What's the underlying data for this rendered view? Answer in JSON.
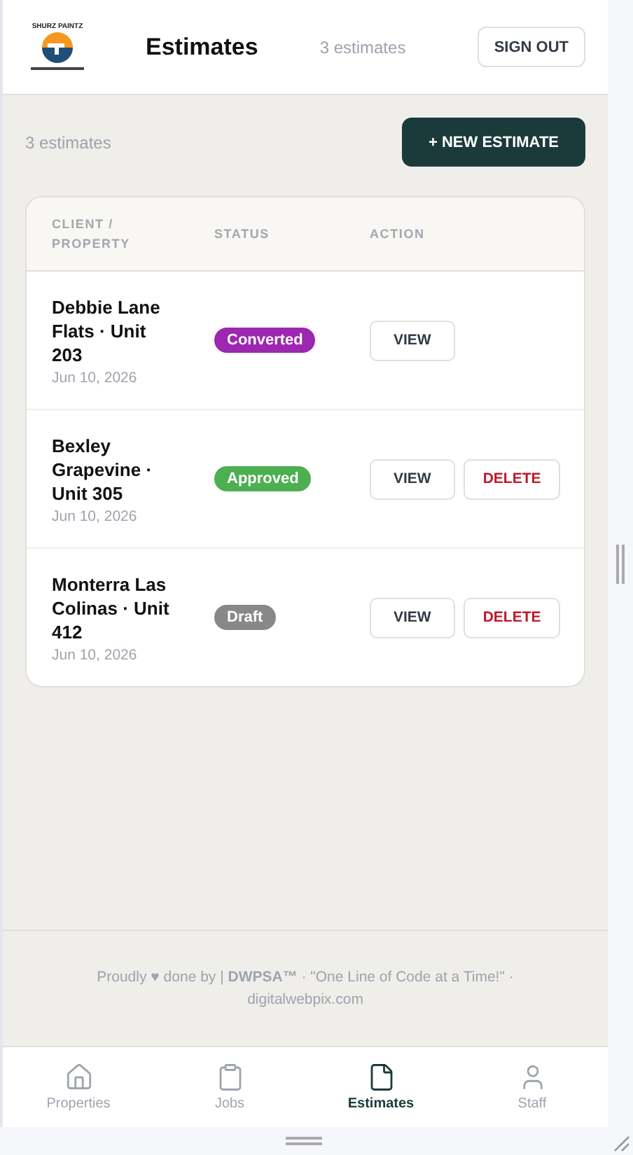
{
  "header": {
    "logo": {
      "name": "SHURZ PAINTZ"
    },
    "title": "Estimates",
    "count": "3 estimates",
    "sign_out": "SIGN OUT"
  },
  "toolbar": {
    "count": "3 estimates",
    "new_button": "+ NEW ESTIMATE"
  },
  "table": {
    "columns": [
      "CLIENT / PROPERTY",
      "STATUS",
      "ACTION"
    ],
    "rows": [
      {
        "name": "Debbie Lane Flats · Unit 203",
        "date": "Jun 10, 2026",
        "status": "Converted",
        "color": "#9c27b0",
        "actions": [
          {
            "kind": "view",
            "label": "VIEW"
          }
        ]
      },
      {
        "name": "Bexley Grapevine · Unit 305",
        "date": "Jun 10, 2026",
        "status": "Approved",
        "color": "#4caf50",
        "actions": [
          {
            "kind": "view",
            "label": "VIEW"
          },
          {
            "kind": "delete",
            "label": "DELETE"
          }
        ]
      },
      {
        "name": "Monterra Las Colinas · Unit 412",
        "date": "Jun 10, 2026",
        "status": "Draft",
        "color": "#888888",
        "actions": [
          {
            "kind": "view",
            "label": "VIEW"
          },
          {
            "kind": "delete",
            "label": "DELETE"
          }
        ]
      }
    ]
  },
  "footer": {
    "text": "Proudly ♥ done by | **DWPSA™**  ·  \"One Line of Code at a Time!\"  ·  digitalwebpix.com"
  },
  "nav": [
    {
      "label": "Properties",
      "selected": false
    },
    {
      "label": "Jobs",
      "selected": false
    },
    {
      "label": "Estimates",
      "selected": true
    },
    {
      "label": "Staff",
      "selected": false
    }
  ]
}
